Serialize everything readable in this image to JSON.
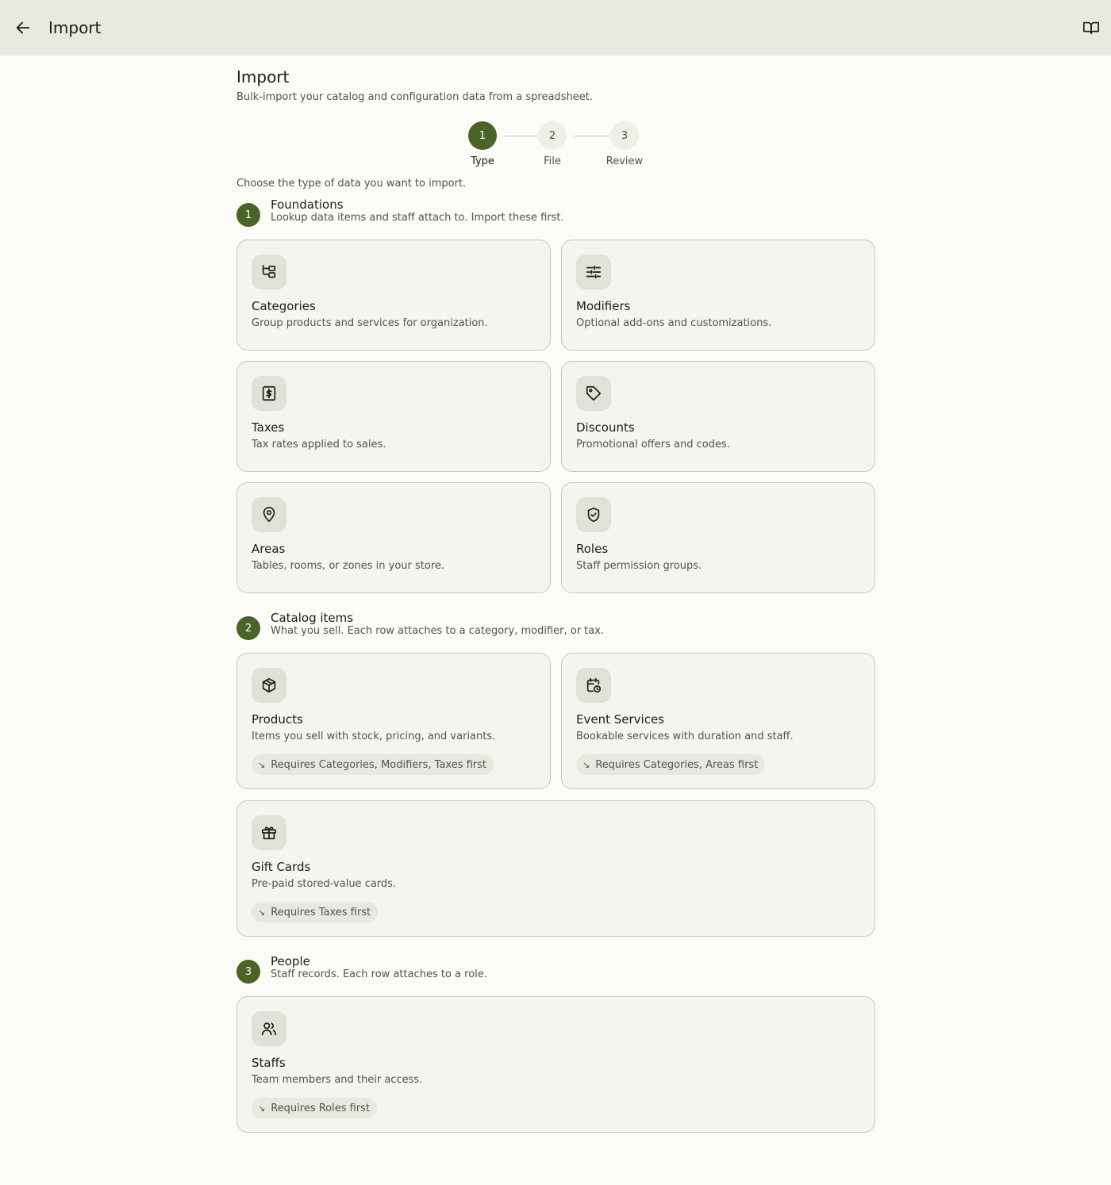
{
  "topbar": {
    "title": "Import",
    "back_icon": "arrow-left-icon",
    "docs_icon": "book-open-icon"
  },
  "page": {
    "title": "Import",
    "subtitle": "Bulk-import your catalog and configuration data from a spreadsheet."
  },
  "stepper": {
    "steps": [
      {
        "number": "1",
        "label": "Type",
        "active": true
      },
      {
        "number": "2",
        "label": "File",
        "active": false
      },
      {
        "number": "3",
        "label": "Review",
        "active": false
      }
    ]
  },
  "instruction": "Choose the type of data you want to import.",
  "sections": [
    {
      "number": "1",
      "title": "Foundations",
      "description": "Lookup data items and staff attach to. Import these first.",
      "cards": [
        {
          "title": "Categories",
          "description": "Group products and services for organization.",
          "icon": "category-tree-icon"
        },
        {
          "title": "Modifiers",
          "description": "Optional add-ons and customizations.",
          "icon": "sliders-icon"
        },
        {
          "title": "Taxes",
          "description": "Tax rates applied to sales.",
          "icon": "receipt-dollar-icon"
        },
        {
          "title": "Discounts",
          "description": "Promotional offers and codes.",
          "icon": "tag-icon"
        },
        {
          "title": "Areas",
          "description": "Tables, rooms, or zones in your store.",
          "icon": "map-pin-icon"
        },
        {
          "title": "Roles",
          "description": "Staff permission groups.",
          "icon": "shield-check-icon"
        }
      ]
    },
    {
      "number": "2",
      "title": "Catalog items",
      "description": "What you sell. Each row attaches to a category, modifier, or tax.",
      "cards": [
        {
          "title": "Products",
          "description": "Items you sell with stock, pricing, and variants.",
          "icon": "package-icon",
          "requires": "Requires Categories, Modifiers, Taxes first"
        },
        {
          "title": "Event Services",
          "description": "Bookable services with duration and staff.",
          "icon": "calendar-clock-icon",
          "requires": "Requires Categories, Areas first"
        },
        {
          "title": "Gift Cards",
          "description": "Pre-paid stored-value cards.",
          "icon": "gift-icon",
          "requires": "Requires Taxes first"
        }
      ]
    },
    {
      "number": "3",
      "title": "People",
      "description": "Staff records. Each row attaches to a role.",
      "cards": [
        {
          "title": "Staffs",
          "description": "Team members and their access.",
          "icon": "users-icon",
          "requires": "Requires Roles first"
        }
      ]
    }
  ],
  "requires_glyph": "↘",
  "colors": {
    "accent": "#4a6326",
    "topbar_bg": "#e6eadf",
    "page_bg": "#fbfcf7",
    "card_bg": "#f3f5ee",
    "card_border": "#c6cabd"
  }
}
